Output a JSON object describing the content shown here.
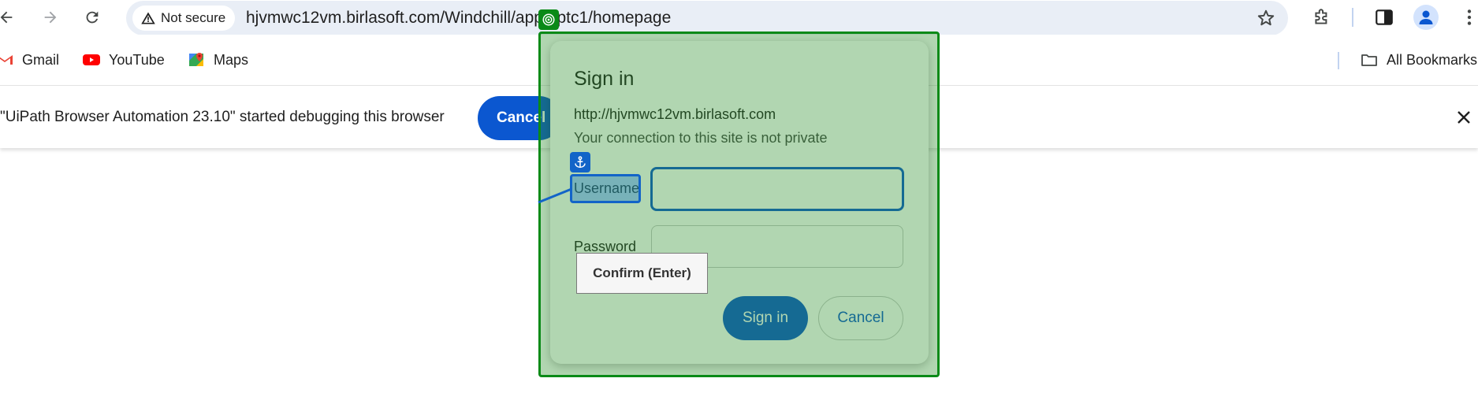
{
  "toolbar": {
    "back_icon": "arrow-left-icon",
    "forward_icon": "arrow-right-icon",
    "reload_icon": "reload-icon",
    "security_label": "Not secure",
    "url": "hjvmwc12vm.birlasoft.com/Windchill/app/#ptc1/homepage",
    "bookmark_star_icon": "star-icon",
    "extensions_icon": "puzzle-icon",
    "side_panel_icon": "side-panel-icon",
    "menu_icon": "more-vert-icon"
  },
  "bookmarks": {
    "items": [
      {
        "label": "Gmail",
        "icon": "gmail-icon"
      },
      {
        "label": "YouTube",
        "icon": "youtube-icon"
      },
      {
        "label": "Maps",
        "icon": "maps-icon"
      }
    ],
    "all_bookmarks": "All Bookmarks"
  },
  "infobar": {
    "message": "\"UiPath Browser Automation 23.10\" started debugging this browser",
    "cancel_label": "Cancel"
  },
  "dialog": {
    "title": "Sign in",
    "url": "http://hjvmwc12vm.birlasoft.com",
    "warning": "Your connection to this site is not private",
    "username_label": "Username",
    "username_value": "",
    "password_label": "Password",
    "password_value": "",
    "signin_label": "Sign in",
    "cancel_label": "Cancel"
  },
  "overlay": {
    "tooltip": "Confirm (Enter)",
    "target_color": "#0a8a17",
    "anchor_color": "#1264c8"
  },
  "colors": {
    "accent": "#0b57d0",
    "omnibox_bg": "#e9eef6"
  }
}
